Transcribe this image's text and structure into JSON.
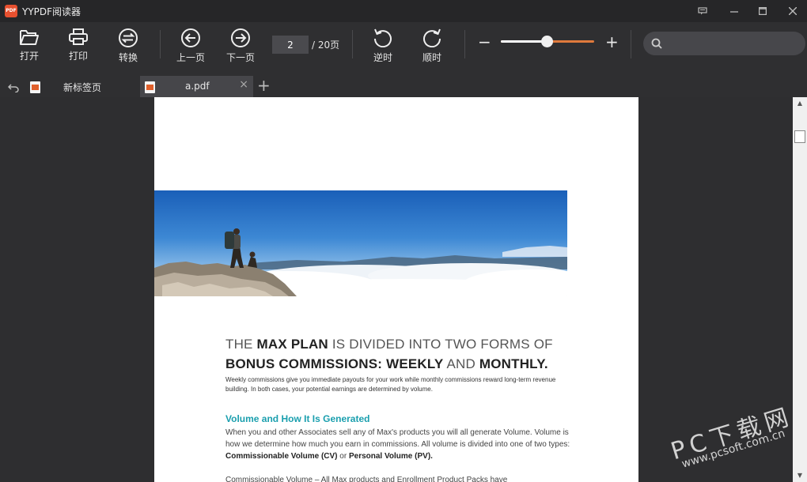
{
  "app": {
    "title": "YYPDF阅读器",
    "logo_text": "PDF"
  },
  "toolbar": {
    "open_label": "打开",
    "print_label": "打印",
    "convert_label": "转换",
    "prev_label": "上一页",
    "next_label": "下一页",
    "current_page": "2",
    "total_pages": "/ 20页",
    "rotate_ccw_label": "逆时",
    "rotate_cw_label": "顺时",
    "zoom_level_fraction": 0.49,
    "search_placeholder": ""
  },
  "tabs": [
    {
      "label": "新标签页",
      "active": false
    },
    {
      "label": "a.pdf",
      "active": true
    }
  ],
  "document": {
    "heading_line1_a": "THE ",
    "heading_line1_b": "MAX PLAN",
    "heading_line1_c": " IS DIVIDED INTO TWO FORMS OF",
    "heading_line2_a": "BONUS COMMISSIONS: WEEKLY",
    "heading_line2_b": " AND ",
    "heading_line2_c": "MONTHLY.",
    "intro": "Weekly commissions give you immediate payouts for your work while monthly commissions reward long-term revenue building. In both cases, your potential earnings are determined by volume.",
    "subheading": "Volume and How It Is Generated",
    "body_1": "When you and other Associates sell any of Max's products you will all generate Volume. Volume is how we determine how much you earn in commissions. All volume is divided into one of two types: ",
    "body_cv": "Commissionable Volume (CV)",
    "body_or": " or ",
    "body_pv": "Personal Volume (PV).",
    "body_cut": "Commissionable Volume – All Max products and Enrollment Product Packs have"
  },
  "watermark": {
    "big": "PC下载网",
    "small": "www.pcsoft.com.cn"
  },
  "colors": {
    "accent": "#e07a3c",
    "subheading": "#1a9fae",
    "logo": "#e8502f"
  }
}
